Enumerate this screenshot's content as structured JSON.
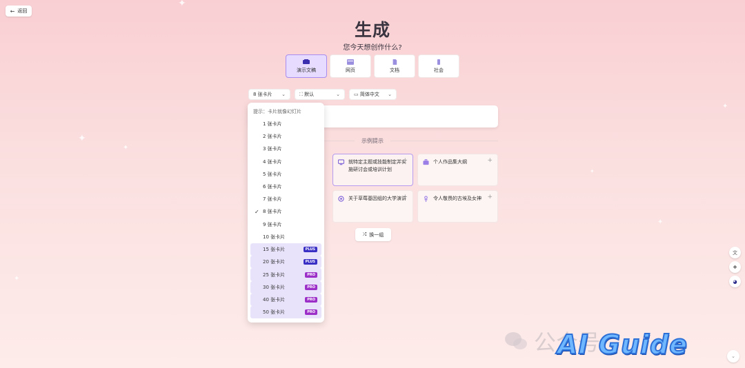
{
  "header": {
    "back_label": "返回",
    "title": "生成",
    "subtitle": "您今天想创作什么?"
  },
  "mode_tabs": [
    {
      "label": "演示文稿",
      "icon": "presentation-icon",
      "active": true
    },
    {
      "label": "网页",
      "icon": "webpage-icon",
      "active": false
    },
    {
      "label": "文档",
      "icon": "document-icon",
      "active": false
    },
    {
      "label": "社会",
      "icon": "social-icon",
      "active": false
    }
  ],
  "selectors": {
    "cards": "8 张卡片",
    "theme": "默认",
    "language": "简体中文"
  },
  "examples": {
    "label": "示例提示",
    "cards": [
      {
        "text": "就特定主题或技能制定并实施研讨会或培训计划"
      },
      {
        "text": "个人作品集大纲"
      },
      {
        "text": "关于草莓基因组的大学演讲"
      },
      {
        "text": "令人敬畏的古埃及女神"
      }
    ],
    "shuffle_label": "换一组"
  },
  "dropdown": {
    "hint": "提示：卡片就像幻灯片",
    "items": [
      {
        "label": "1 张卡片"
      },
      {
        "label": "2 张卡片"
      },
      {
        "label": "3 张卡片"
      },
      {
        "label": "4 张卡片"
      },
      {
        "label": "5 张卡片"
      },
      {
        "label": "6 张卡片"
      },
      {
        "label": "7 张卡片"
      },
      {
        "label": "8 张卡片",
        "selected": true
      },
      {
        "label": "9 张卡片"
      },
      {
        "label": "10 张卡片"
      },
      {
        "label": "15 张卡片",
        "badge": "PLUS"
      },
      {
        "label": "20 张卡片",
        "badge": "PLUS"
      },
      {
        "label": "25 张卡片",
        "badge": "PRO"
      },
      {
        "label": "30 张卡片",
        "badge": "PRO"
      },
      {
        "label": "40 张卡片",
        "badge": "PRO"
      },
      {
        "label": "50 张卡片",
        "badge": "PRO"
      }
    ]
  },
  "watermark": {
    "text": "公众号",
    "logo": "AI Guide"
  },
  "colors": {
    "accent": "#a88bf0",
    "plus_badge": "#3a2fc4",
    "pro_badge": "#9b2fc8"
  }
}
